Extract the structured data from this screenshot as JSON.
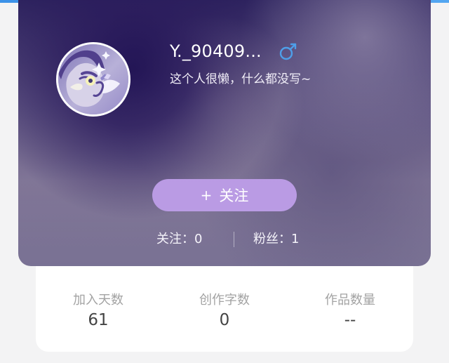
{
  "profile": {
    "username": "Y._90409...",
    "bio": "这个人很懒，什么都没写~",
    "gender_icon": "male-icon",
    "accent_color": "#b898e3"
  },
  "actions": {
    "follow_plus": "+",
    "follow_label": "关注"
  },
  "social": {
    "following_text": "关注：0",
    "fans_text": "粉丝：1"
  },
  "stats": [
    {
      "label": "加入天数",
      "value": "61"
    },
    {
      "label": "创作字数",
      "value": "0"
    },
    {
      "label": "作品数量",
      "value": "--"
    }
  ]
}
